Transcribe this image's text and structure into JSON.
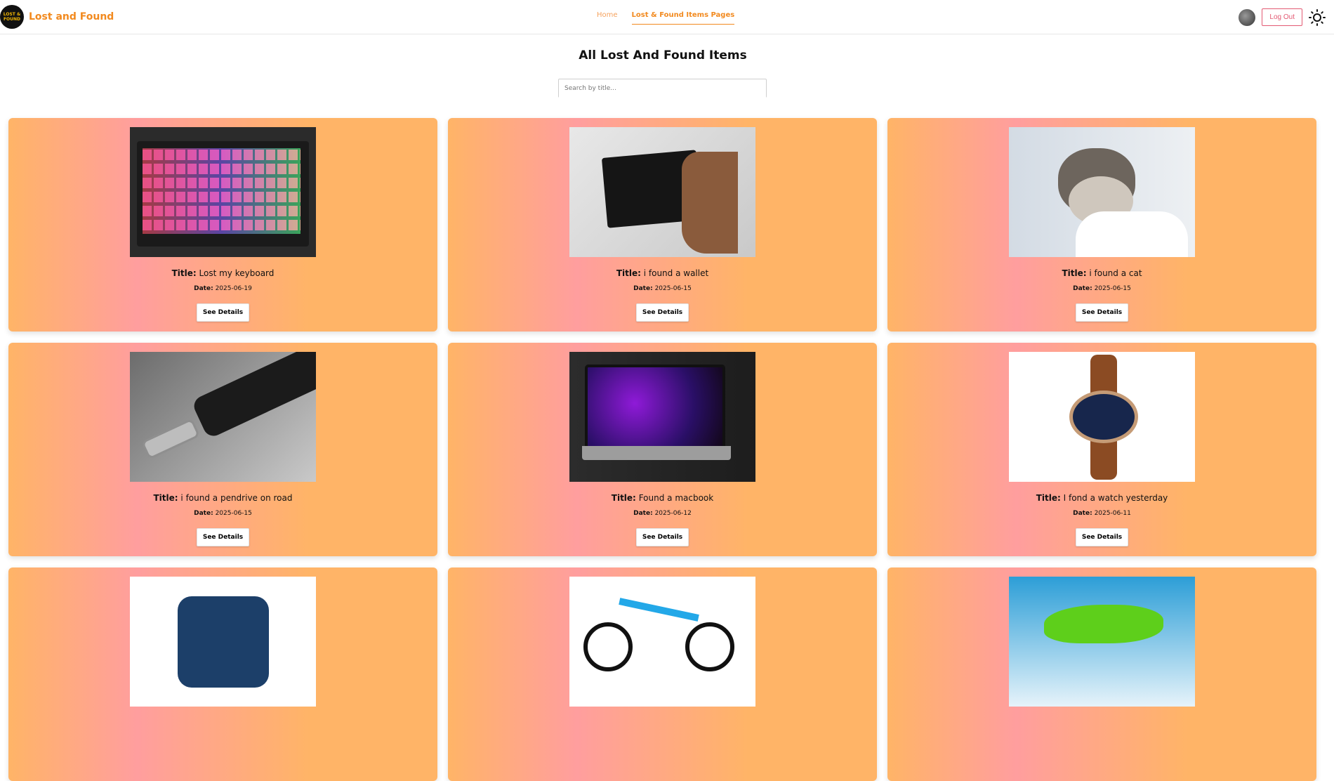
{
  "brand": {
    "logo_text_1": "LOST &",
    "logo_text_2": "FOUND",
    "name": "Lost and Found"
  },
  "nav": {
    "home": "Home",
    "items_pages": "Lost & Found Items Pages"
  },
  "actions": {
    "logout": "Log Out"
  },
  "page": {
    "title": "All Lost And Found Items",
    "search_placeholder": "Search by title..."
  },
  "labels": {
    "title": "Title:",
    "date": "Date:",
    "details": "See Details"
  },
  "items": [
    {
      "title": "Lost my keyboard",
      "date": "2025-06-19",
      "image": "keyboard"
    },
    {
      "title": "i found a wallet",
      "date": "2025-06-15",
      "image": "wallet"
    },
    {
      "title": "i found a cat",
      "date": "2025-06-15",
      "image": "kitten"
    },
    {
      "title": "i found a pendrive on road",
      "date": "2025-06-15",
      "image": "usb-drive"
    },
    {
      "title": "Found a macbook",
      "date": "2025-06-12",
      "image": "laptop"
    },
    {
      "title": "I fond a watch yesterday",
      "date": "2025-06-11",
      "image": "watch"
    },
    {
      "image": "phone"
    },
    {
      "image": "bicycle"
    },
    {
      "image": "motorcycle"
    }
  ],
  "colors": {
    "accent": "#f28a1f",
    "logout": "#e35a73",
    "card_left": "#ffb467",
    "card_mid": "#ff9e9e"
  }
}
